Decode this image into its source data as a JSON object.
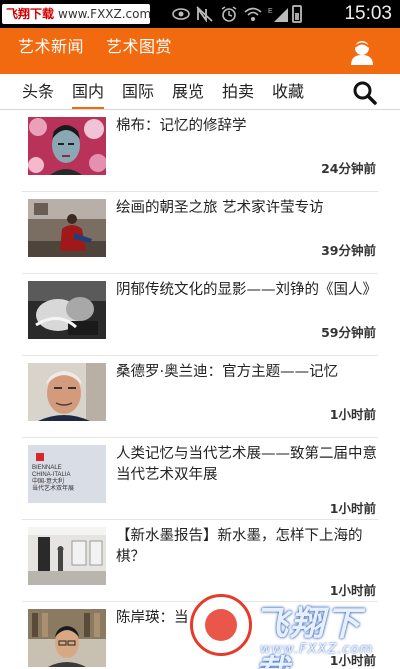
{
  "status_bar": {
    "watermark_site": "飞翔下载",
    "watermark_url": "www.FXXZ.com",
    "time": "15:03"
  },
  "app_header": {
    "tabs": [
      "艺术新闻",
      "艺术图赏"
    ]
  },
  "category_nav": {
    "items": [
      "头条",
      "国内",
      "国际",
      "展览",
      "拍卖",
      "收藏"
    ],
    "active": "国内"
  },
  "news": [
    {
      "title": "棉布：记忆的修辞学",
      "time": "24分钟前"
    },
    {
      "title": "绘画的朝圣之旅 艺术家许莹专访",
      "time": "39分钟前"
    },
    {
      "title": "阴郁传统文化的显影——刘铮的《国人》",
      "time": "59分钟前"
    },
    {
      "title": "桑德罗·奥兰迪：官方主题——记忆",
      "time": "1小时前"
    },
    {
      "title": "人类记忆与当代艺术展——致第二届中意当代艺术双年展",
      "time": "1小时前",
      "thumb_text": [
        "BIENNALE",
        "CHINA-ITALIA",
        "中国-意大利",
        "当代艺术双年展"
      ]
    },
    {
      "title": "【新水墨报告】新水墨，怎样下上海的棋？",
      "time": "1小时前"
    },
    {
      "title": "陈岸瑛：当",
      "time": "1小时前"
    }
  ],
  "watermark": {
    "title": "飞翔下载",
    "url": "www.FXXZ.com"
  }
}
